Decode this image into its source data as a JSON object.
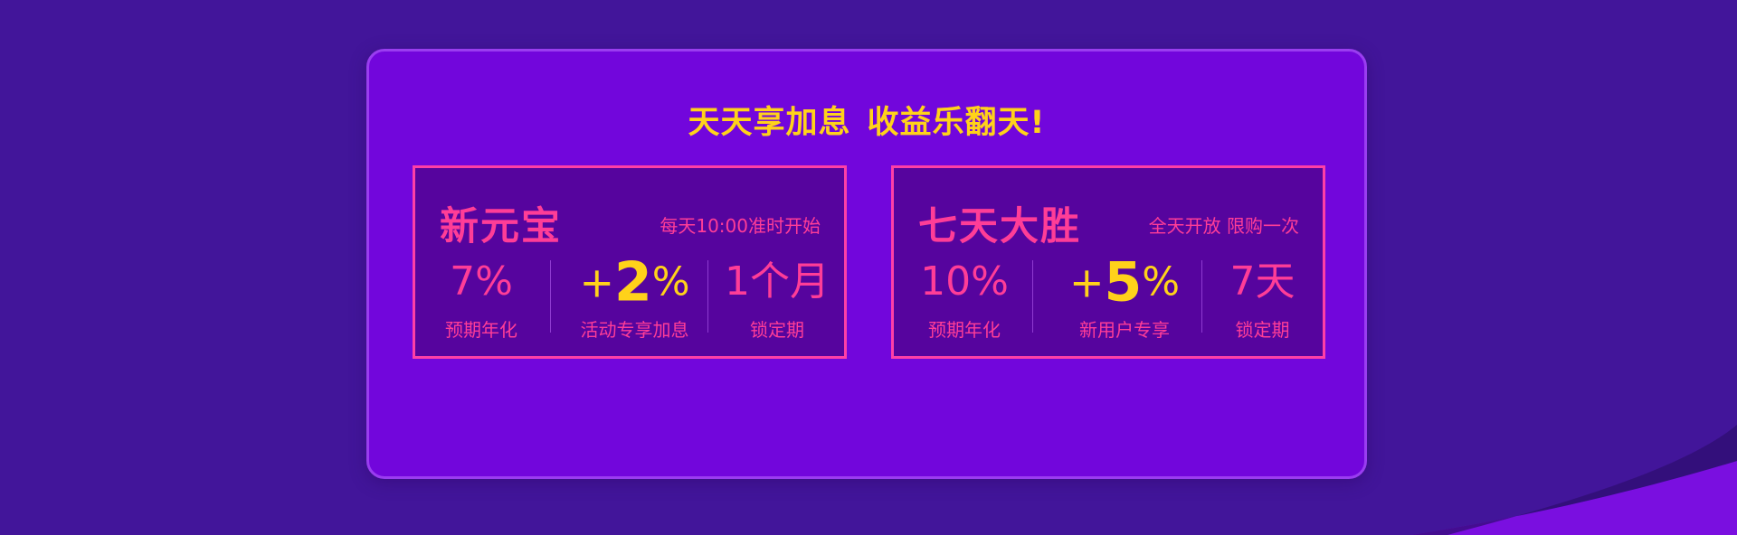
{
  "headline": {
    "part1": "天天享加息",
    "part2": "收益乐翻天!"
  },
  "cards": [
    {
      "title": "新元宝",
      "note": "每天10:00准时开始",
      "stats": [
        {
          "value": "7%",
          "label": "预期年化"
        },
        {
          "plus": "+",
          "value": "2",
          "suffix": "%",
          "label": "活动专享加息"
        },
        {
          "value": "1个月",
          "label": "锁定期"
        }
      ]
    },
    {
      "title": "七天大胜",
      "note": "全天开放 限购一次",
      "stats": [
        {
          "value": "10%",
          "label": "预期年化"
        },
        {
          "plus": "+",
          "value": "5",
          "suffix": "%",
          "label": "新用户专享"
        },
        {
          "value": "7天",
          "label": "锁定期"
        }
      ]
    }
  ],
  "colors": {
    "background": "#42159a",
    "panel": "#7206dc",
    "card": "#56049e",
    "accent_pink": "#ff3d97",
    "accent_yellow": "#ffd21a"
  }
}
